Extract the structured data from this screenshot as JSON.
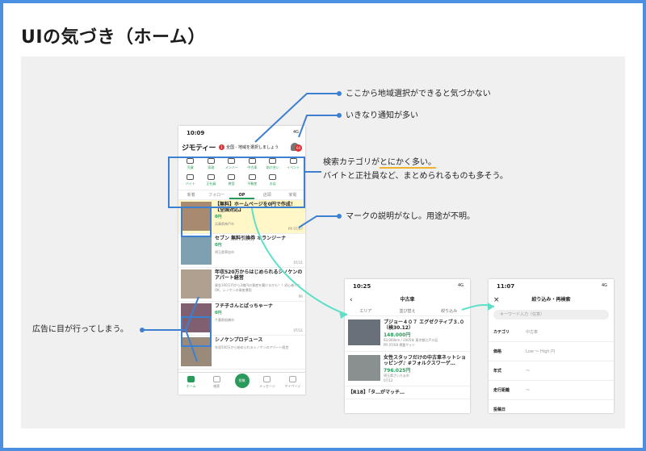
{
  "slide": {
    "title": "UIの気づき（ホーム）"
  },
  "home": {
    "time": "10:09",
    "status": "4G",
    "logo": "ジモティー",
    "region_prompt": "全国 - 地域を選択しましょう",
    "region_num": "1",
    "notif_count": "64",
    "categories": [
      "売買",
      "家政",
      "メンバー",
      "中古車",
      "助け合い",
      "イベント",
      "バイト",
      "正社員",
      "教室",
      "不動産",
      "お店"
    ],
    "tabs": [
      "新着",
      "フォロー",
      "OP",
      "店頭",
      "家電"
    ],
    "items": [
      {
        "title": "【無料】ホームページを0円で作成！【全国対応】",
        "price": "0円",
        "meta": "兵庫県神戸市",
        "badge": "PR 07/07"
      },
      {
        "title": "セブン 無料引換券 オランジーナ",
        "price": "0円",
        "meta": "埼玉県草加市",
        "badge": "07/11"
      },
      {
        "title": "年収520万からはじめられるシノケンのアパート経営",
        "price": "資金100万円から2億円の資産を築けるかも！？初心者でもOK、シノケンの資産運用",
        "meta": "",
        "badge": "PR"
      },
      {
        "title": "フチ子さんとぱっちゃーナ",
        "price": "0円",
        "meta": "千葉県船橋市",
        "badge": "07/11"
      },
      {
        "title": "シノケンプロデュース",
        "price": "年収500万から始められるシノケンのアパート経営",
        "meta": "",
        "badge": ""
      }
    ],
    "nav": [
      "ホーム",
      "検索",
      "投稿",
      "メッセージ",
      "マイページ"
    ]
  },
  "cars": {
    "time": "10:25",
    "title": "中古車",
    "tabs": [
      "エリア",
      "並び替え",
      "絞り込み"
    ],
    "items": [
      {
        "title": "プジョー４０７ エグゼクティブ３.０（検30.12）",
        "price": "148.000円",
        "meta": "93,000km / 2005年 東京都江戸川区",
        "badge": "PR 07/08 掲載サイト"
      },
      {
        "title": "女性スタッフだけの中古車ネットショッピング♪ #フォルクスワーゲ…",
        "price": "796.025円",
        "meta": "埼玉県さいたま市",
        "badge": "07/12"
      },
      {
        "title": "【R18】「タ…がマッチ…",
        "price": "",
        "meta": "",
        "badge": ""
      }
    ]
  },
  "filter": {
    "time": "11:07",
    "title": "絞り込み・再検索",
    "search_placeholder": "キーワード入力（任意）",
    "rows": [
      {
        "label": "カテゴリ",
        "value": "中古車"
      },
      {
        "label": "価格",
        "value": "Low 〜 High 円"
      },
      {
        "label": "年式",
        "value": "〜"
      },
      {
        "label": "走行距離",
        "value": "〜"
      },
      {
        "label": "投稿日",
        "value": ""
      }
    ]
  },
  "annotations": {
    "a1": "ここから地域選択ができると気づかない",
    "a2": "いきなり通知が多い",
    "a3_pre": "検索カテゴリが",
    "a3_hl": "とにかく多い。",
    "a3_post": "バイトと正社員など、まとめられるものも多そう。",
    "a4": "マークの説明がなし。用途が不明。",
    "a5": "広告に目が行ってしまう。"
  },
  "colors": {
    "accent": "#3d7fd0",
    "brand": "#2a9a5a",
    "teal": "#5ee0c8"
  }
}
